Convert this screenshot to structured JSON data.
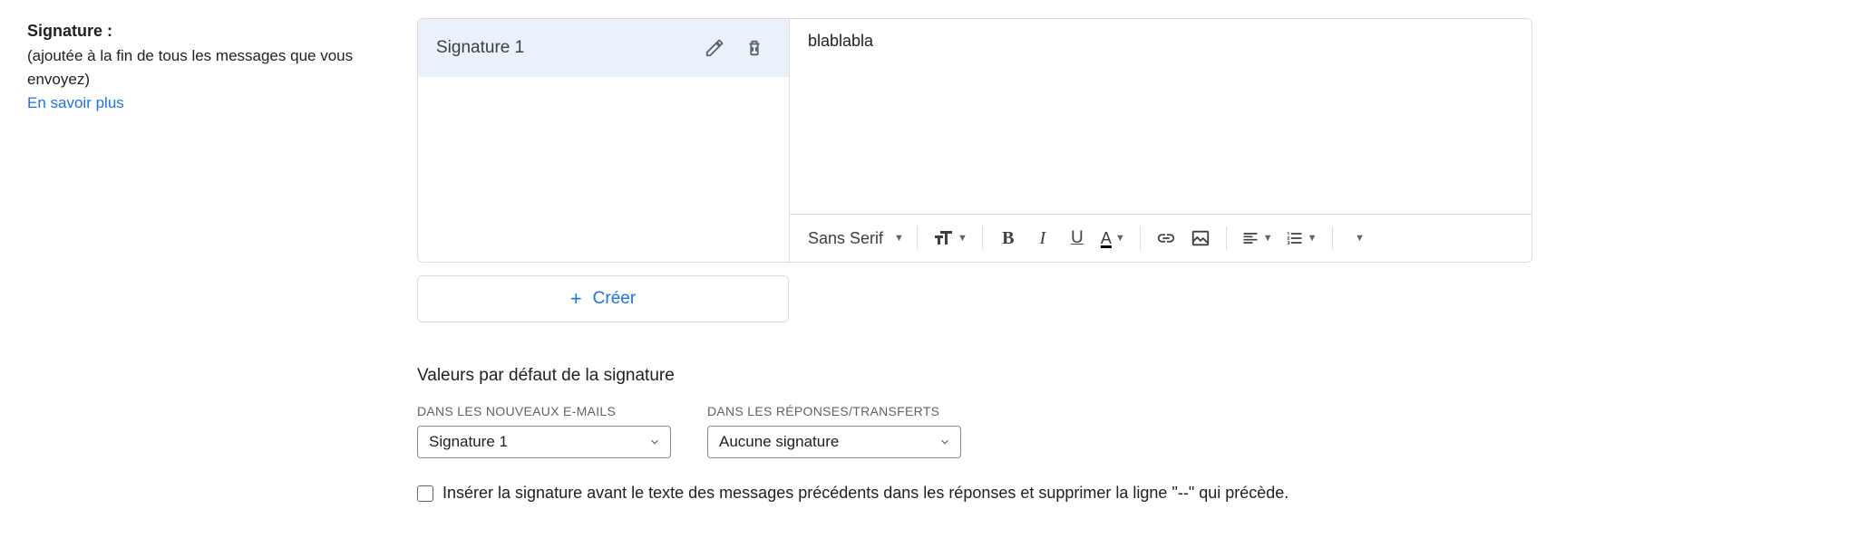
{
  "left": {
    "title": "Signature :",
    "description": "(ajoutée à la fin de tous les messages que vous envoyez)",
    "learn_more": "En savoir plus"
  },
  "signatures": [
    {
      "name": "Signature 1"
    }
  ],
  "editor": {
    "content": "blablabla",
    "font_family": "Sans Serif"
  },
  "create_label": "Créer",
  "defaults": {
    "title": "Valeurs par défaut de la signature",
    "new_emails_label": "DANS LES NOUVEAUX E-MAILS",
    "replies_label": "DANS LES RÉPONSES/TRANSFERTS",
    "new_emails_value": "Signature 1",
    "replies_value": "Aucune signature",
    "checkbox_label": "Insérer la signature avant le texte des messages précédents dans les réponses et supprimer la ligne \"--\" qui précède."
  }
}
